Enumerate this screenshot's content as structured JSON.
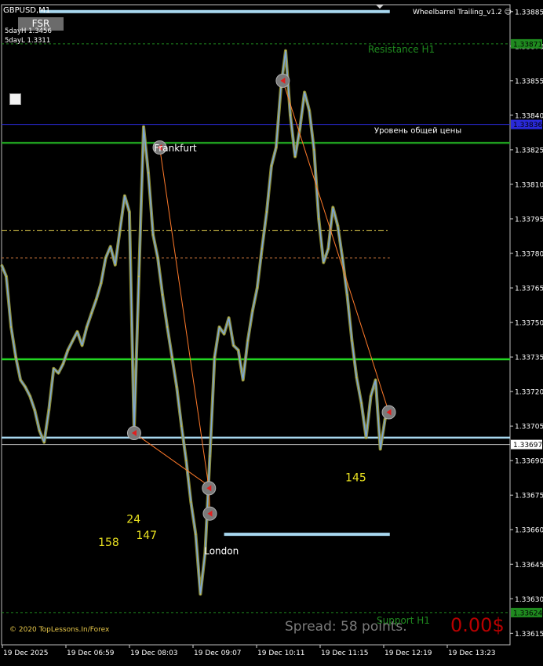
{
  "header": {
    "symbol_timeframe": "GBPUSD,M1",
    "indicator_name": "Wheelbarrel Trailing_v1.2",
    "fsr_button": "FSR",
    "day_high": "5dayH 1.3456",
    "day_low": "5dayL 1.3311"
  },
  "footer": {
    "copyright": "© 2020 TopLessons.In/Forex",
    "spread": "Spread: 58 points.",
    "profit": "0.00$"
  },
  "chart_data": {
    "type": "line",
    "symbol": "GBPUSD",
    "timeframe": "M1",
    "xlim": [
      "19 Dec 05:15",
      "19 Dec 14:12"
    ],
    "ylim": [
      1.3361,
      1.33888
    ],
    "y_ticks": [
      "1.33885",
      "1.33870",
      "1.33855",
      "1.33840",
      "1.33825",
      "1.33810",
      "1.33795",
      "1.33780",
      "1.33765",
      "1.33750",
      "1.33735",
      "1.33720",
      "1.33705",
      "1.33690",
      "1.33675",
      "1.33660",
      "1.33645",
      "1.33630",
      "1.33615"
    ],
    "x_ticks": [
      "19 Dec 2025",
      "19 Dec 06:59",
      "19 Dec 08:03",
      "19 Dec 09:07",
      "19 Dec 10:11",
      "19 Dec 11:15",
      "19 Dec 12:19",
      "19 Dec 13:23"
    ],
    "price_series": [
      [
        "19 Dec 05:15",
        1.33775
      ],
      [
        "19 Dec 05:20",
        1.3377
      ],
      [
        "19 Dec 05:25",
        1.33748
      ],
      [
        "19 Dec 05:30",
        1.33735
      ],
      [
        "19 Dec 05:35",
        1.33725
      ],
      [
        "19 Dec 05:40",
        1.33722
      ],
      [
        "19 Dec 05:45",
        1.33718
      ],
      [
        "19 Dec 05:50",
        1.33712
      ],
      [
        "19 Dec 05:55",
        1.33703
      ],
      [
        "19 Dec 06:00",
        1.33698
      ],
      [
        "19 Dec 06:05",
        1.33712
      ],
      [
        "19 Dec 06:10",
        1.3373
      ],
      [
        "19 Dec 06:15",
        1.33728
      ],
      [
        "19 Dec 06:20",
        1.33732
      ],
      [
        "19 Dec 06:25",
        1.33738
      ],
      [
        "19 Dec 06:30",
        1.33742
      ],
      [
        "19 Dec 06:35",
        1.33746
      ],
      [
        "19 Dec 06:40",
        1.3374
      ],
      [
        "19 Dec 06:45",
        1.33748
      ],
      [
        "19 Dec 06:50",
        1.33754
      ],
      [
        "19 Dec 06:55",
        1.3376
      ],
      [
        "19 Dec 07:00",
        1.33767
      ],
      [
        "19 Dec 07:05",
        1.33778
      ],
      [
        "19 Dec 07:10",
        1.33783
      ],
      [
        "19 Dec 07:15",
        1.33775
      ],
      [
        "19 Dec 07:20",
        1.3379
      ],
      [
        "19 Dec 07:25",
        1.33805
      ],
      [
        "19 Dec 07:30",
        1.33798
      ],
      [
        "19 Dec 07:35",
        1.33703
      ],
      [
        "19 Dec 07:40",
        1.3377
      ],
      [
        "19 Dec 07:45",
        1.33835
      ],
      [
        "19 Dec 07:50",
        1.33815
      ],
      [
        "19 Dec 07:55",
        1.33788
      ],
      [
        "19 Dec 08:00",
        1.33778
      ],
      [
        "19 Dec 08:05",
        1.33762
      ],
      [
        "19 Dec 08:10",
        1.33748
      ],
      [
        "19 Dec 08:15",
        1.33735
      ],
      [
        "19 Dec 08:20",
        1.33722
      ],
      [
        "19 Dec 08:25",
        1.33705
      ],
      [
        "19 Dec 08:30",
        1.3369
      ],
      [
        "19 Dec 08:35",
        1.33672
      ],
      [
        "19 Dec 08:40",
        1.33658
      ],
      [
        "19 Dec 08:45",
        1.33632
      ],
      [
        "19 Dec 08:50",
        1.3365
      ],
      [
        "19 Dec 08:55",
        1.33692
      ],
      [
        "19 Dec 09:00",
        1.33735
      ],
      [
        "19 Dec 09:05",
        1.33748
      ],
      [
        "19 Dec 09:10",
        1.33745
      ],
      [
        "19 Dec 09:15",
        1.33752
      ],
      [
        "19 Dec 09:20",
        1.3374
      ],
      [
        "19 Dec 09:25",
        1.33738
      ],
      [
        "19 Dec 09:30",
        1.33725
      ],
      [
        "19 Dec 09:35",
        1.33742
      ],
      [
        "19 Dec 09:40",
        1.33755
      ],
      [
        "19 Dec 09:45",
        1.33765
      ],
      [
        "19 Dec 09:50",
        1.33782
      ],
      [
        "19 Dec 09:55",
        1.33798
      ],
      [
        "19 Dec 10:00",
        1.33818
      ],
      [
        "19 Dec 10:05",
        1.33826
      ],
      [
        "19 Dec 10:10",
        1.33852
      ],
      [
        "19 Dec 10:15",
        1.33868
      ],
      [
        "19 Dec 10:20",
        1.3384
      ],
      [
        "19 Dec 10:25",
        1.33822
      ],
      [
        "19 Dec 10:30",
        1.33834
      ],
      [
        "19 Dec 10:35",
        1.3385
      ],
      [
        "19 Dec 10:40",
        1.33842
      ],
      [
        "19 Dec 10:45",
        1.33825
      ],
      [
        "19 Dec 10:50",
        1.33795
      ],
      [
        "19 Dec 10:55",
        1.33776
      ],
      [
        "19 Dec 11:00",
        1.33782
      ],
      [
        "19 Dec 11:05",
        1.338
      ],
      [
        "19 Dec 11:10",
        1.33792
      ],
      [
        "19 Dec 11:15",
        1.33778
      ],
      [
        "19 Dec 11:20",
        1.33762
      ],
      [
        "19 Dec 11:25",
        1.33742
      ],
      [
        "19 Dec 11:30",
        1.33726
      ],
      [
        "19 Dec 11:35",
        1.33715
      ],
      [
        "19 Dec 11:40",
        1.337
      ],
      [
        "19 Dec 11:45",
        1.33718
      ],
      [
        "19 Dec 11:50",
        1.33725
      ],
      [
        "19 Dec 11:55",
        1.33695
      ],
      [
        "19 Dec 12:00",
        1.33708
      ],
      [
        "19 Dec 12:05",
        1.33712
      ]
    ],
    "levels": [
      {
        "label": "Resistance H1",
        "value": 1.33871,
        "color": "#1f8a1f",
        "style": "dashed"
      },
      {
        "label": "Уровень общей цены",
        "value": 1.33836,
        "color": "#2a2ad8",
        "style": "solid"
      },
      {
        "label": "",
        "value": 1.33828,
        "color": "#1e9c1e",
        "style": "solid"
      },
      {
        "label": "",
        "value": 1.3379,
        "color": "#e8d44d",
        "style": "dashdot"
      },
      {
        "label": "",
        "value": 1.33778,
        "color": "#c0703a",
        "style": "dashed"
      },
      {
        "label": "",
        "value": 1.33734,
        "color": "#22d622",
        "style": "solid"
      },
      {
        "label": "",
        "value": 1.337,
        "color": "#a8d8f0",
        "style": "solid"
      },
      {
        "label": "",
        "value": 1.33697,
        "color": "#c8c8c8",
        "style": "solid"
      },
      {
        "label": "Support H1",
        "value": 1.33624,
        "color": "#1f8a1f",
        "style": "dashed"
      }
    ],
    "segments": [
      {
        "from": [
          "19 Dec 05:55",
          1.33885
        ],
        "to": [
          "19 Dec 12:05",
          1.33885
        ],
        "color": "#a8d8f0"
      },
      {
        "from": [
          "19 Dec 09:10",
          1.33658
        ],
        "to": [
          "19 Dec 12:05",
          1.33658
        ],
        "color": "#a8d8f0"
      }
    ],
    "trend_lines": [
      {
        "from": [
          "19 Dec 08:02",
          1.33826
        ],
        "to": [
          "19 Dec 08:54",
          1.33678
        ]
      },
      {
        "from": [
          "19 Dec 07:35",
          1.33702
        ],
        "to": [
          "19 Dec 08:54",
          1.33679
        ]
      },
      {
        "from": [
          "19 Dec 08:54",
          1.33678
        ],
        "to": [
          "19 Dec 08:55",
          1.33667
        ]
      },
      {
        "from": [
          "19 Dec 10:12",
          1.33855
        ],
        "to": [
          "19 Dec 12:04",
          1.33711
        ]
      }
    ],
    "markers": [
      {
        "at": [
          "19 Dec 08:02",
          1.33826
        ],
        "type": "circle"
      },
      {
        "at": [
          "19 Dec 07:35",
          1.33702
        ],
        "type": "circle"
      },
      {
        "at": [
          "19 Dec 08:54",
          1.33678
        ],
        "type": "circle"
      },
      {
        "at": [
          "19 Dec 08:55",
          1.33667
        ],
        "type": "circle"
      },
      {
        "at": [
          "19 Dec 10:12",
          1.33855
        ],
        "type": "circle"
      },
      {
        "at": [
          "19 Dec 12:04",
          1.33711
        ],
        "type": "circle"
      }
    ],
    "level_price_labels": [
      {
        "value": 1.33871,
        "text": "1.33871",
        "bg": "#1f8a1f"
      },
      {
        "value": 1.33836,
        "text": "1.33836",
        "bg": "#2a2ad8"
      },
      {
        "value": 1.33697,
        "text": "1.33697",
        "bg": "#ffffff"
      },
      {
        "value": 1.33624,
        "text": "1.33624",
        "bg": "#1f8a1f"
      }
    ],
    "session_labels": [
      {
        "text": "Frankfurt",
        "at": [
          "19 Dec 07:56",
          1.33826
        ]
      },
      {
        "text": "London",
        "at": [
          "19 Dec 08:49",
          1.33651
        ]
      }
    ],
    "annotations": [
      {
        "text": "158",
        "at": [
          "19 Dec 06:57",
          1.33653
        ],
        "color": "#e8e020"
      },
      {
        "text": "24",
        "at": [
          "19 Dec 07:27",
          1.33663
        ],
        "color": "#e8e020"
      },
      {
        "text": "147",
        "at": [
          "19 Dec 07:37",
          1.33656
        ],
        "color": "#e8e020"
      },
      {
        "text": "145",
        "at": [
          "19 Dec 11:18",
          1.33681
        ],
        "color": "#e8e020"
      }
    ]
  }
}
